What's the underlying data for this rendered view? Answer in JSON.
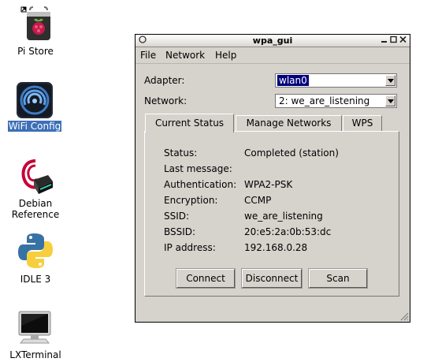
{
  "desktop": {
    "icons": [
      {
        "label": "Pi Store",
        "icon": "pi-store-icon",
        "selected": false
      },
      {
        "label": "WiFi Config",
        "icon": "wifi-config-icon",
        "selected": true
      },
      {
        "label": "Debian",
        "label2": "Reference",
        "icon": "debian-reference-icon",
        "selected": false
      },
      {
        "label": "IDLE 3",
        "icon": "python-idle-icon",
        "selected": false
      },
      {
        "label": "LXTerminal",
        "icon": "terminal-icon",
        "selected": false
      }
    ]
  },
  "window": {
    "title": "wpa_gui",
    "menu": [
      "File",
      "Network",
      "Help"
    ],
    "adapter_label": "Adapter:",
    "adapter_value": "wlan0",
    "network_label": "Network:",
    "network_value": "2: we_are_listening",
    "tabs": [
      "Current Status",
      "Manage Networks",
      "WPS"
    ],
    "active_tab": "Current Status",
    "status": [
      {
        "key": "Status:",
        "value": "Completed (station)"
      },
      {
        "key": "Last message:",
        "value": ""
      },
      {
        "key": "Authentication:",
        "value": "WPA2-PSK"
      },
      {
        "key": "Encryption:",
        "value": "CCMP"
      },
      {
        "key": "SSID:",
        "value": "we_are_listening"
      },
      {
        "key": "BSSID:",
        "value": "20:e5:2a:0b:53:dc"
      },
      {
        "key": "IP address:",
        "value": "192.168.0.28"
      }
    ],
    "buttons": [
      "Connect",
      "Disconnect",
      "Scan"
    ]
  },
  "colors": {
    "selection": "#3c6fb7",
    "combo_highlight": "#00007c",
    "window_bg": "#d6d2cc"
  }
}
